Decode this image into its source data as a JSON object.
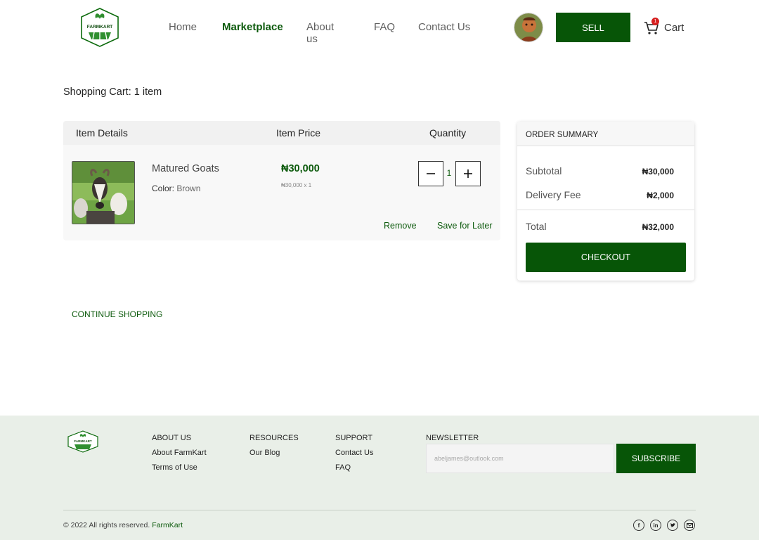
{
  "brand": {
    "logo_text": "FARMKART",
    "accent": "#075507"
  },
  "nav": {
    "items": [
      {
        "label": "Home"
      },
      {
        "label": "Marketplace"
      },
      {
        "label": "About us"
      },
      {
        "label": "FAQ"
      },
      {
        "label": "Contact Us"
      }
    ],
    "active": "Marketplace"
  },
  "header": {
    "sell_label": "SELL",
    "cart_label": "Cart",
    "cart_count": "1"
  },
  "page": {
    "title": "Shopping Cart: 1 item"
  },
  "cart": {
    "columns": [
      "Item Details",
      "Item Price",
      "Quantity"
    ],
    "items": [
      {
        "name": "Matured Goats",
        "color_label": "Color:",
        "color": "Brown",
        "price": "₦30,000",
        "price_breakdown": "₦30,000 x 1",
        "quantity": "1",
        "remove_label": "Remove",
        "save_label": "Save for Later"
      }
    ],
    "continue_label": "CONTINUE SHOPPING"
  },
  "summary": {
    "title": "ORDER SUMMARY",
    "subtotal_label": "Subtotal",
    "subtotal": "₦30,000",
    "delivery_label": "Delivery Fee",
    "delivery": "₦2,000",
    "total_label": "Total",
    "total": "₦32,000",
    "checkout_label": "CHECKOUT"
  },
  "footer": {
    "about": {
      "heading": "ABOUT US",
      "links": [
        "About FarmKart",
        "Terms of Use"
      ]
    },
    "resources": {
      "heading": "RESOURCES",
      "links": [
        "Our Blog"
      ]
    },
    "support": {
      "heading": "SUPPORT",
      "links": [
        "Contact Us",
        "FAQ"
      ]
    },
    "newsletter": {
      "heading": "NEWSLETTER",
      "placeholder": "abeljames@outlook.com",
      "button": "SUBSCRIBE"
    },
    "copyright": "© 2022 All rights reserved.",
    "copyright_brand": "FarmKart",
    "socials": [
      "facebook-icon",
      "linkedin-icon",
      "twitter-icon",
      "mail-icon"
    ]
  }
}
